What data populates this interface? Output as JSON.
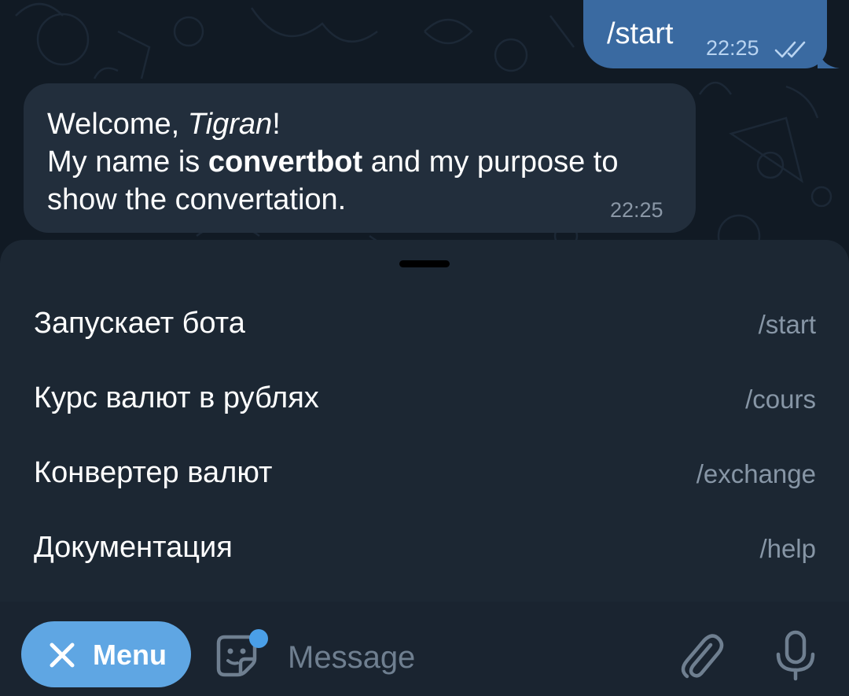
{
  "chat": {
    "outgoing": {
      "text": "/start",
      "time": "22:25",
      "status_icon": "double-check-icon"
    },
    "incoming": {
      "greeting_prefix": "Welcome, ",
      "user_name": "Tigran",
      "greeting_suffix": "!",
      "line2_prefix": "My name is ",
      "bot_name": "convertbot",
      "line2_suffix": " and my purpose to",
      "line3": "show the convertation.",
      "time": "22:25"
    }
  },
  "commands": [
    {
      "description": "Запускает бота",
      "command": "/start"
    },
    {
      "description": "Курс валют в рублях",
      "command": "/cours"
    },
    {
      "description": "Конвертер валют",
      "command": "/exchange"
    },
    {
      "description": "Документация",
      "command": "/help"
    }
  ],
  "input_bar": {
    "menu_label": "Menu",
    "placeholder": "Message",
    "icons": [
      "close-icon",
      "sticker-icon",
      "attach-icon",
      "microphone-icon"
    ]
  },
  "colors": {
    "chat_background": "#111a24",
    "outgoing_bubble": "#3a6aa1",
    "incoming_bubble": "#222e3c",
    "sheet_background": "#1c2733",
    "menu_button": "#5fa6e3",
    "secondary_text": "#8796a6"
  }
}
